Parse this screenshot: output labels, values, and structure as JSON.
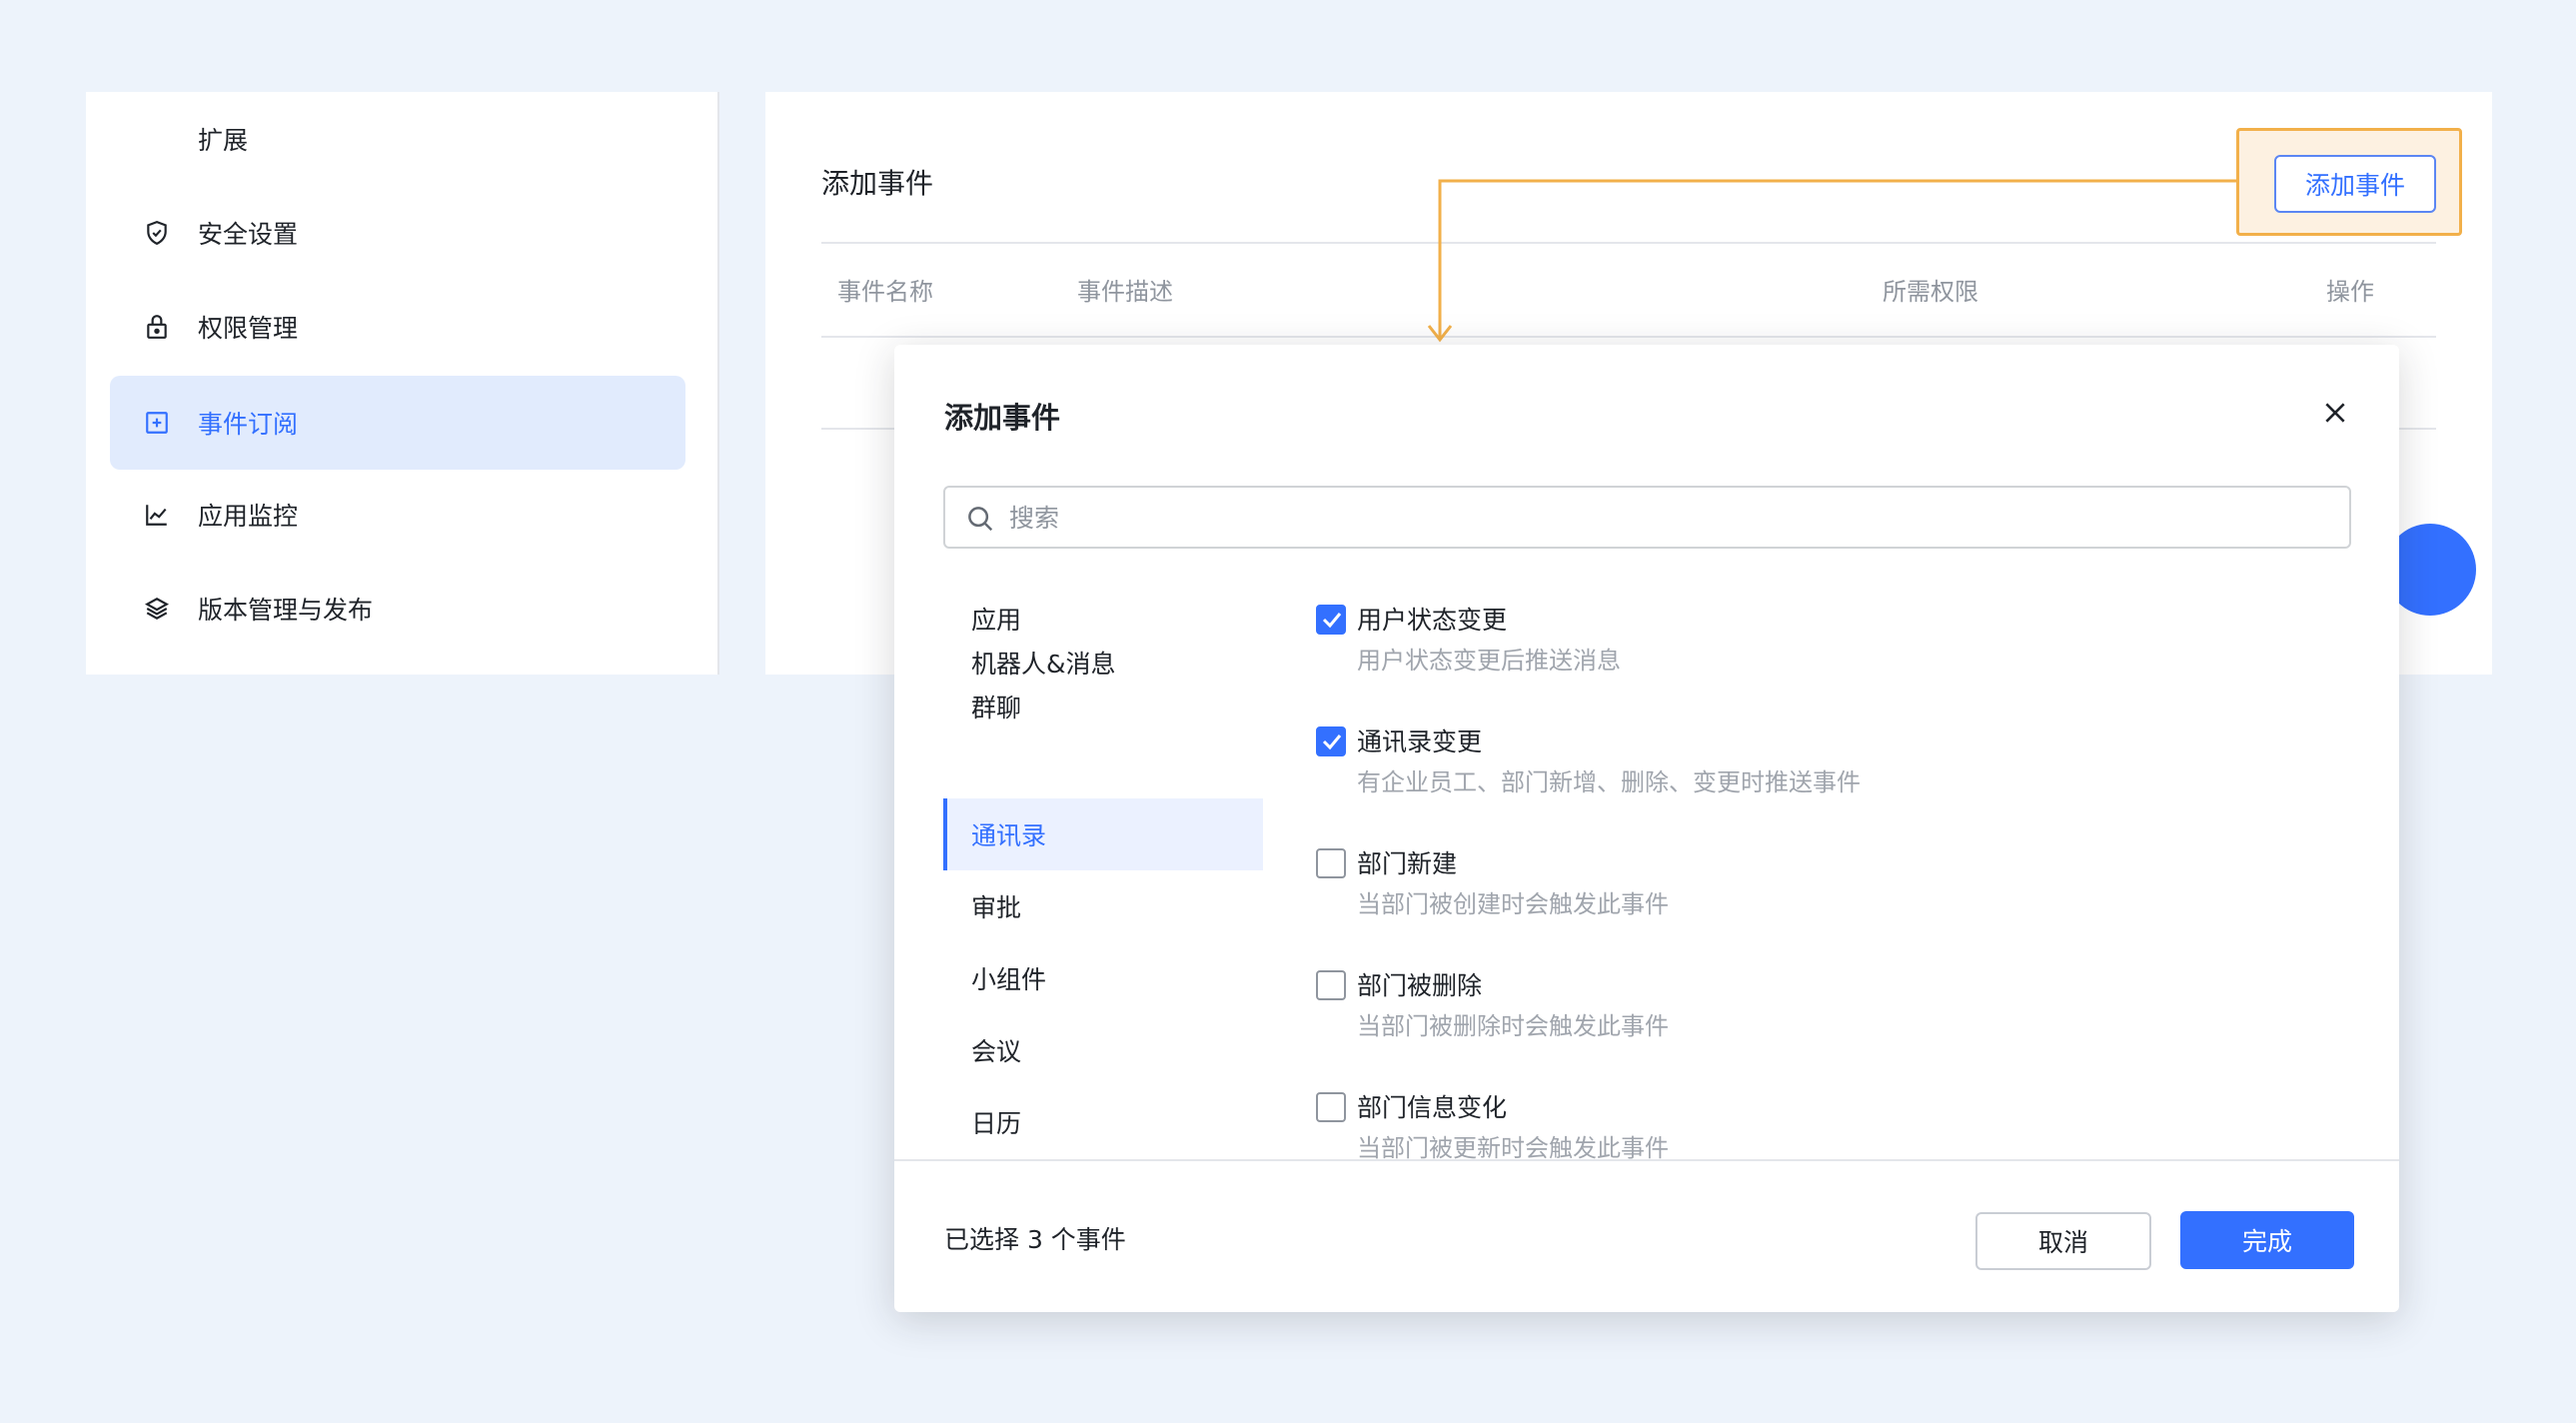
{
  "sidebar": {
    "items": [
      {
        "label": "扩展",
        "icon": "none",
        "active": false
      },
      {
        "label": "安全设置",
        "icon": "shield-icon",
        "active": false
      },
      {
        "label": "权限管理",
        "icon": "lock-icon",
        "active": false
      },
      {
        "label": "事件订阅",
        "icon": "plus-square-icon",
        "active": true
      },
      {
        "label": "应用监控",
        "icon": "line-chart-icon",
        "active": false
      },
      {
        "label": "版本管理与发布",
        "icon": "layers-icon",
        "active": false
      }
    ]
  },
  "main": {
    "title": "添加事件",
    "add_button_label": "添加事件",
    "table_headers": [
      "事件名称",
      "事件描述",
      "所需权限",
      "操作"
    ]
  },
  "modal": {
    "title": "添加事件",
    "search_placeholder": "搜索",
    "categories": [
      {
        "label": "应用",
        "active": false
      },
      {
        "label": "机器人&消息",
        "active": false
      },
      {
        "label": "群聊",
        "active": false
      },
      {
        "label": "通讯录",
        "active": true
      },
      {
        "label": "审批",
        "active": false
      },
      {
        "label": "小组件",
        "active": false
      },
      {
        "label": "会议",
        "active": false
      },
      {
        "label": "日历",
        "active": false
      }
    ],
    "events": [
      {
        "name": "用户状态变更",
        "desc": "用户状态变更后推送消息",
        "checked": true
      },
      {
        "name": "通讯录变更",
        "desc": "有企业员工、部门新增、删除、变更时推送事件",
        "checked": true
      },
      {
        "name": "部门新建",
        "desc": "当部门被创建时会触发此事件",
        "checked": false
      },
      {
        "name": "部门被删除",
        "desc": "当部门被删除时会触发此事件",
        "checked": false
      },
      {
        "name": "部门信息变化",
        "desc": "当部门被更新时会触发此事件",
        "checked": false
      }
    ],
    "selected_text": "已选择 3 个事件",
    "cancel_label": "取消",
    "ok_label": "完成"
  },
  "colors": {
    "accent": "#3370ff",
    "highlight": "#f2b04a",
    "background": "#edf3fb"
  }
}
